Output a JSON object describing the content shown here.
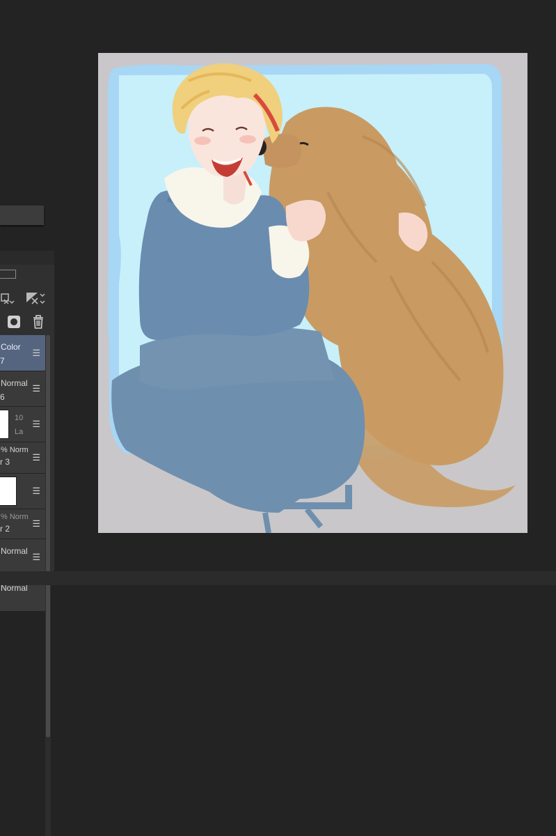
{
  "layers": [
    {
      "line1": "Color",
      "line2": "7",
      "selected": true
    },
    {
      "line1": "Normal",
      "line2": "6",
      "selected": false
    },
    {
      "line1": "10",
      "line2": "La",
      "selected": false,
      "thumb": true
    },
    {
      "line1": "%  Norm",
      "line2": "r 3",
      "selected": false
    },
    {
      "line1": "",
      "line2": "",
      "selected": false,
      "thumb": true
    },
    {
      "line1": "%  Norm",
      "line2": "r 2",
      "selected": false
    },
    {
      "line1": "Normal",
      "line2": "",
      "selected": false
    },
    {
      "line1": "Normal",
      "line2": "",
      "selected": false
    }
  ],
  "icons": {
    "merge_down": "merge-layer-icon",
    "clear": "clear-layer-icon",
    "mask": "layer-mask-icon",
    "delete": "trash-icon",
    "row_menu": "hamburger-icon"
  },
  "colors": {
    "workspace": "#232323",
    "canvas_bg": "#c9c7c9",
    "sky": "#c7f0fb",
    "frame_blue": "#a8d6f5",
    "denim": "#6f8fae",
    "dog": "#c99b63",
    "hair": "#f0cf7d",
    "hoodie": "#f8f5ea",
    "selected_layer": "#55657f"
  }
}
